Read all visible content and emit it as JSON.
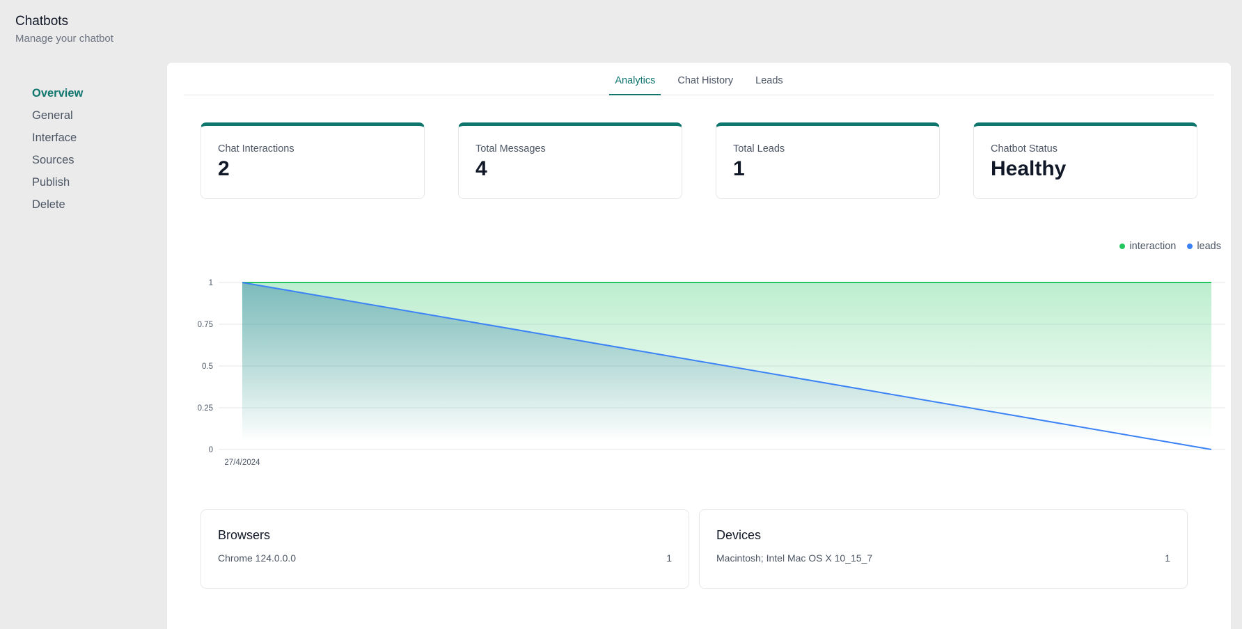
{
  "header": {
    "title": "Chatbots",
    "subtitle": "Manage your chatbot"
  },
  "sidebar": {
    "items": [
      {
        "label": "Overview",
        "active": true
      },
      {
        "label": "General"
      },
      {
        "label": "Interface"
      },
      {
        "label": "Sources"
      },
      {
        "label": "Publish"
      },
      {
        "label": "Delete"
      }
    ]
  },
  "tabs": [
    {
      "label": "Analytics",
      "active": true
    },
    {
      "label": "Chat History"
    },
    {
      "label": "Leads"
    }
  ],
  "stats": [
    {
      "label": "Chat Interactions",
      "value": "2"
    },
    {
      "label": "Total Messages",
      "value": "4"
    },
    {
      "label": "Total Leads",
      "value": "1"
    },
    {
      "label": "Chatbot Status",
      "value": "Healthy"
    }
  ],
  "colors": {
    "accent": "#0f766e",
    "interaction": "#22c55e",
    "leads": "#3b82f6"
  },
  "chart_data": {
    "type": "area",
    "x": [
      "27/4/2024",
      ""
    ],
    "x_tick_labels": [
      "27/4/2024"
    ],
    "y_ticks": [
      "0",
      "0.25",
      "0.5",
      "0.75",
      "1"
    ],
    "ylim": [
      0,
      1
    ],
    "series": [
      {
        "name": "interaction",
        "values": [
          1,
          1
        ],
        "color": "#22c55e"
      },
      {
        "name": "leads",
        "values": [
          1,
          0
        ],
        "color": "#3b82f6"
      }
    ],
    "legend_position": "top-right",
    "grid": true
  },
  "browsers": {
    "title": "Browsers",
    "rows": [
      {
        "name": "Chrome 124.0.0.0",
        "count": "1"
      }
    ]
  },
  "devices": {
    "title": "Devices",
    "rows": [
      {
        "name": "Macintosh; Intel Mac OS X 10_15_7",
        "count": "1"
      }
    ]
  }
}
